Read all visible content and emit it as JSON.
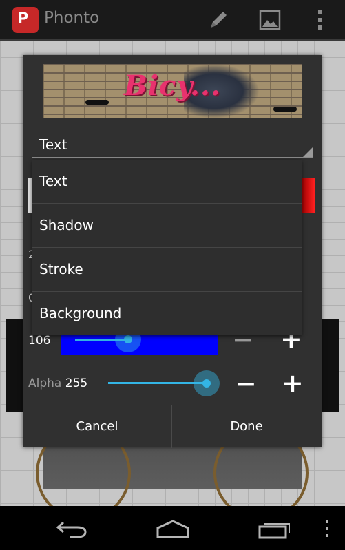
{
  "app": {
    "title": "Phonto",
    "icon_letter": "P"
  },
  "actionbar": {
    "icons": [
      "pencil-icon",
      "image-icon",
      "overflow-menu-icon"
    ]
  },
  "preview": {
    "text": "Bicy..."
  },
  "spinner": {
    "selected": "Text"
  },
  "dropdown": {
    "items": [
      {
        "label": "Text"
      },
      {
        "label": "Shadow"
      },
      {
        "label": "Stroke"
      },
      {
        "label": "Background"
      }
    ]
  },
  "partial_rows": {
    "row1": "2",
    "row2": "0"
  },
  "color_row": {
    "value": "106"
  },
  "alpha": {
    "label": "Alpha",
    "value": "255",
    "level": 1.0
  },
  "buttons": {
    "cancel": "Cancel",
    "done": "Done"
  },
  "colors": {
    "accent": "#33b5e5",
    "swatch_blue": "#0000ff",
    "swatch_red": "#ff2020",
    "app_icon": "#c62828",
    "preview_text": "#e8326e"
  },
  "navbar": {
    "icons": [
      "back-icon",
      "home-icon",
      "recent-apps-icon",
      "overflow-menu-icon"
    ]
  }
}
